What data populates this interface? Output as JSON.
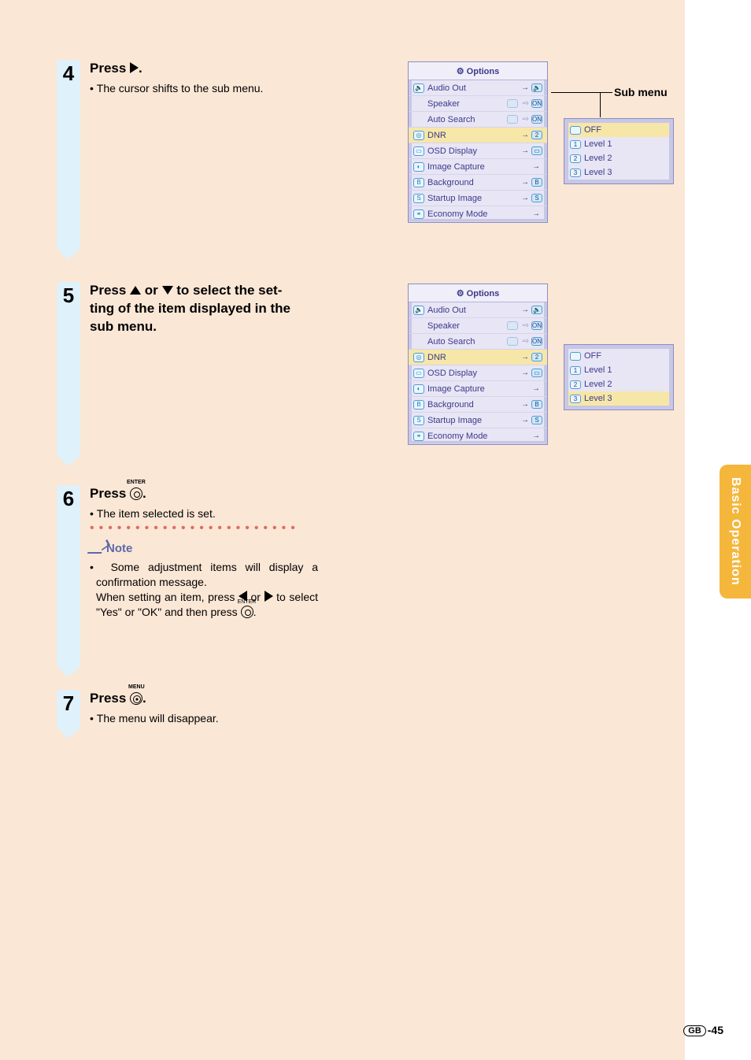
{
  "sideTab": "Basic Operation",
  "pageNumber": "-45",
  "pageRegion": "GB",
  "subMenuLabel": "Sub menu",
  "steps": {
    "s4": {
      "num": "4",
      "titleA": "Press ",
      "titleB": ".",
      "sub": "The cursor shifts to the sub menu."
    },
    "s5": {
      "num": "5",
      "titleA": "Press ",
      "titleMid": " or ",
      "titleB": " to select the set-",
      "line2": "ting of the item displayed in the",
      "line3": "sub menu."
    },
    "s6": {
      "num": "6",
      "titleA": "Press ",
      "titleB": ".",
      "btnLabel": "ENTER",
      "sub": "The item selected is set.",
      "noteHead": "Note",
      "note1": "Some adjustment items will display a confirmation message.",
      "note2a": "When setting an item, press ",
      "note2b": " or ",
      "note2c": " to select \"Yes\" or \"OK\" and then press ",
      "note2d": ".",
      "enterSmall": "ENTER"
    },
    "s7": {
      "num": "7",
      "titleA": "Press ",
      "titleB": ".",
      "btnLabel": "MENU",
      "sub": "The menu will disappear."
    }
  },
  "osd": {
    "title": "Options",
    "rows": [
      {
        "ico": "🔈",
        "label": "Audio Out",
        "val": "🔈"
      },
      {
        "ico": "",
        "label": "Speaker",
        "toggle": true,
        "val": "ON"
      },
      {
        "ico": "",
        "label": "Auto Search",
        "toggle": true,
        "val": "ON"
      },
      {
        "ico": "◎",
        "label": "DNR",
        "val": "2",
        "hl": true
      },
      {
        "ico": "▭",
        "label": "OSD Display",
        "val": "▭"
      },
      {
        "ico": "◐",
        "label": "Image Capture",
        "val": ""
      },
      {
        "ico": "B",
        "label": "Background",
        "val": "B"
      },
      {
        "ico": "S",
        "label": "Startup Image",
        "val": "S"
      },
      {
        "ico": "⚭",
        "label": "Economy Mode",
        "val": ""
      }
    ]
  },
  "sub4": {
    "hlIndex": 0,
    "rows": [
      {
        "ico": "OFF",
        "label": "OFF"
      },
      {
        "ico": "1",
        "label": "Level 1"
      },
      {
        "ico": "2",
        "label": "Level 2"
      },
      {
        "ico": "3",
        "label": "Level 3"
      }
    ]
  },
  "sub5": {
    "hlIndex": 3,
    "rows": [
      {
        "ico": "OFF",
        "label": "OFF"
      },
      {
        "ico": "1",
        "label": "Level 1"
      },
      {
        "ico": "2",
        "label": "Level 2"
      },
      {
        "ico": "3",
        "label": "Level 3"
      }
    ]
  }
}
